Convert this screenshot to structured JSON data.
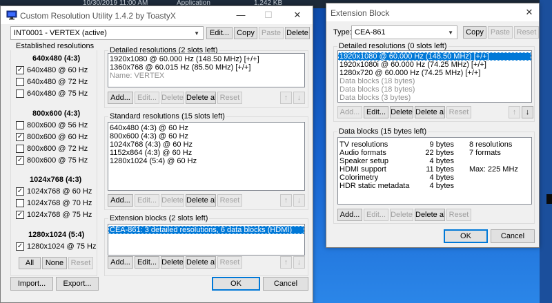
{
  "background": {
    "taskbar_text": [
      "10/30/2019 11:00 AM",
      "Application",
      "1,242 KB"
    ]
  },
  "cru": {
    "title": "Custom Resolution Utility 1.4.2 by ToastyX",
    "display_select": "INT0001 - VERTEX (active)",
    "top_buttons": {
      "edit": "Edit...",
      "copy": "Copy",
      "paste": "Paste",
      "delete": "Delete"
    },
    "established": {
      "label": "Established resolutions",
      "groups": [
        {
          "header": "640x480 (4:3)",
          "items": [
            {
              "label": "640x480 @ 60 Hz",
              "checked": true
            },
            {
              "label": "640x480 @ 72 Hz",
              "checked": false
            },
            {
              "label": "640x480 @ 75 Hz",
              "checked": false
            }
          ]
        },
        {
          "header": "800x600 (4:3)",
          "items": [
            {
              "label": "800x600 @ 56 Hz",
              "checked": false
            },
            {
              "label": "800x600 @ 60 Hz",
              "checked": true
            },
            {
              "label": "800x600 @ 72 Hz",
              "checked": false
            },
            {
              "label": "800x600 @ 75 Hz",
              "checked": true
            }
          ]
        },
        {
          "header": "1024x768 (4:3)",
          "items": [
            {
              "label": "1024x768 @ 60 Hz",
              "checked": true
            },
            {
              "label": "1024x768 @ 70 Hz",
              "checked": false
            },
            {
              "label": "1024x768 @ 75 Hz",
              "checked": true
            }
          ]
        },
        {
          "header": "1280x1024 (5:4)",
          "items": [
            {
              "label": "1280x1024 @ 75 Hz",
              "checked": true
            }
          ]
        }
      ],
      "buttons": {
        "all": "All",
        "none": "None",
        "reset": "Reset"
      }
    },
    "detailed": {
      "label": "Detailed resolutions (2 slots left)",
      "items": [
        "1920x1080 @ 60.000 Hz (148.50 MHz) [+/+]",
        "1360x768 @ 60.015 Hz (85.50 MHz) [+/+]"
      ],
      "name_line": "Name: VERTEX"
    },
    "standard": {
      "label": "Standard resolutions (15 slots left)",
      "items": [
        "640x480 (4:3) @ 60 Hz",
        "800x600 (4:3) @ 60 Hz",
        "1024x768 (4:3) @ 60 Hz",
        "1152x864 (4:3) @ 60 Hz",
        "1280x1024 (5:4) @ 60 Hz"
      ]
    },
    "extension": {
      "label": "Extension blocks (2 slots left)",
      "items": [
        "CEA-861: 3 detailed resolutions, 6 data blocks (HDMI)"
      ]
    },
    "list_buttons": {
      "add": "Add...",
      "edit": "Edit...",
      "delete": "Delete",
      "delete_all": "Delete all",
      "reset": "Reset"
    },
    "arrows": {
      "up": "↑",
      "down": "↓"
    },
    "bottom_buttons": {
      "import": "Import...",
      "export": "Export...",
      "ok": "OK",
      "cancel": "Cancel"
    }
  },
  "ext": {
    "title": "Extension Block",
    "type_label": "Type:",
    "type_value": "CEA-861",
    "top_buttons": {
      "copy": "Copy",
      "paste": "Paste",
      "reset": "Reset"
    },
    "detailed": {
      "label": "Detailed resolutions (0 slots left)",
      "items": [
        {
          "text": "1920x1080 @ 60.000 Hz (148.50 MHz) [+/+]",
          "style": "sel"
        },
        {
          "text": "1920x1080i @ 60.000 Hz (74.25 MHz) [+/+]",
          "style": ""
        },
        {
          "text": "1280x720 @ 60.000 Hz (74.25 MHz) [+/+]",
          "style": ""
        },
        {
          "text": "Data blocks (18 bytes)",
          "style": "gray"
        },
        {
          "text": "Data blocks (18 bytes)",
          "style": "gray"
        },
        {
          "text": "Data blocks (3 bytes)",
          "style": "gray"
        }
      ]
    },
    "datablocks": {
      "label": "Data blocks (15 bytes left)",
      "names": [
        "TV resolutions",
        "Audio formats",
        "Speaker setup",
        "HDMI support",
        "Colorimetry",
        "HDR static metadata"
      ],
      "sizes": [
        "9 bytes",
        "22 bytes",
        "4 bytes",
        "11 bytes",
        "4 bytes",
        "4 bytes"
      ],
      "info": [
        "8 resolutions",
        "7 formats",
        "",
        "Max: 225 MHz",
        "",
        ""
      ]
    },
    "list_buttons": {
      "add": "Add...",
      "edit": "Edit...",
      "delete": "Delete",
      "delete_all": "Delete all",
      "reset": "Reset"
    },
    "arrows": {
      "up": "↑",
      "down": "↓"
    },
    "bottom_buttons": {
      "ok": "OK",
      "cancel": "Cancel"
    }
  }
}
